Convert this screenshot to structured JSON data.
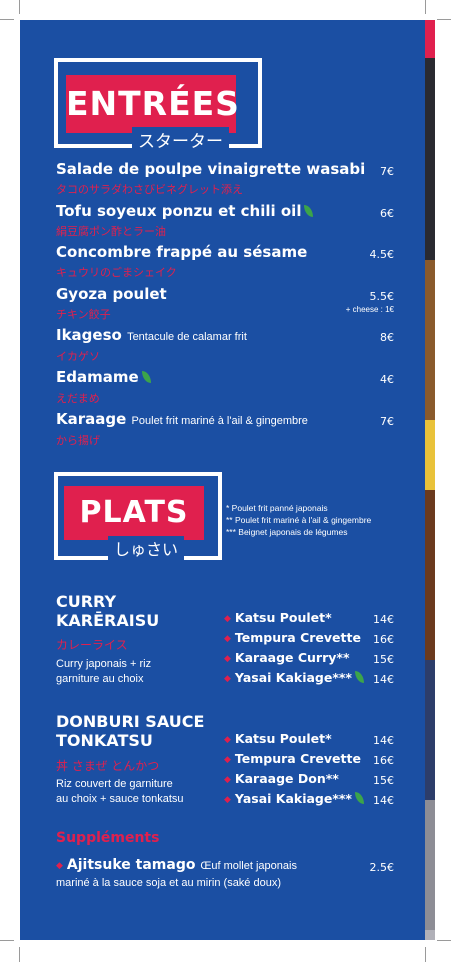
{
  "entrees": {
    "title": "ENTRÉES",
    "title_jp": "スターター",
    "items": [
      {
        "name": "Salade de poulpe vinaigrette wasabi",
        "jp": "タコのサラダわさびビネグレット添え",
        "price": "7€"
      },
      {
        "name": "Tofu soyeux ponzu et chili oil",
        "jp": "絹豆腐ポン酢とラー油",
        "price": "6€",
        "icon": "leaf-icon"
      },
      {
        "name": "Concombre frappé au sésame",
        "jp": "キュウリのごまシェイク",
        "price": "4.5€"
      },
      {
        "name": "Gyoza poulet",
        "jp": "チキン餃子",
        "price": "5.5€",
        "note": "+ cheese : 1€"
      },
      {
        "name": "Ikageso",
        "desc": "Tentacule de calamar frit",
        "jp": "イカゲソ",
        "price": "8€"
      },
      {
        "name": "Edamame",
        "jp": "えだまめ",
        "price": "4€",
        "icon": "leaf-icon"
      },
      {
        "name": "Karaage",
        "desc": "Poulet frit mariné à l'ail & gingembre",
        "jp": "から揚げ",
        "price": "7€"
      }
    ]
  },
  "plats": {
    "title": "PLATS",
    "title_jp": "しゅさい",
    "footnotes": [
      "* Poulet frit panné japonais",
      "** Poulet frit mariné à l'ail & gingembre",
      "*** Beignet japonais de légumes"
    ],
    "dishes": [
      {
        "title_line1": "CURRY",
        "title_line2": "KARĒRAISU",
        "jp": "カレーライス",
        "desc_line1": "Curry japonais + riz",
        "desc_line2": "garniture au choix",
        "options": [
          {
            "name": "Katsu Poulet*",
            "price": "14€"
          },
          {
            "name": "Tempura Crevette",
            "price": "16€"
          },
          {
            "name": "Karaage Curry**",
            "price": "15€"
          },
          {
            "name": "Yasai Kakiage***",
            "price": "14€",
            "icon": "leaf-icon"
          }
        ]
      },
      {
        "title_line1": "DONBURI SAUCE",
        "title_line2": "TONKATSU",
        "jp": "丼 さまぜ とんかつ",
        "desc_line1": "Riz couvert de garniture",
        "desc_line2": "au choix + sauce tonkatsu",
        "options": [
          {
            "name": "Katsu Poulet*",
            "price": "14€"
          },
          {
            "name": "Tempura Crevette",
            "price": "16€"
          },
          {
            "name": "Karaage Don**",
            "price": "15€"
          },
          {
            "name": "Yasai Kakiage***",
            "price": "14€",
            "icon": "leaf-icon"
          }
        ]
      }
    ]
  },
  "supplements": {
    "title": "Suppléments",
    "item_name": "Ajitsuke tamago",
    "item_desc_line1": "Œuf mollet japonais",
    "item_desc_line2": "mariné à la sauce soja et au mirin (saké doux)",
    "price": "2.5€"
  },
  "colors": {
    "background": "#1b4fa3",
    "accent": "#e0204e",
    "text": "#ffffff",
    "leaf": "#3ca44a"
  }
}
